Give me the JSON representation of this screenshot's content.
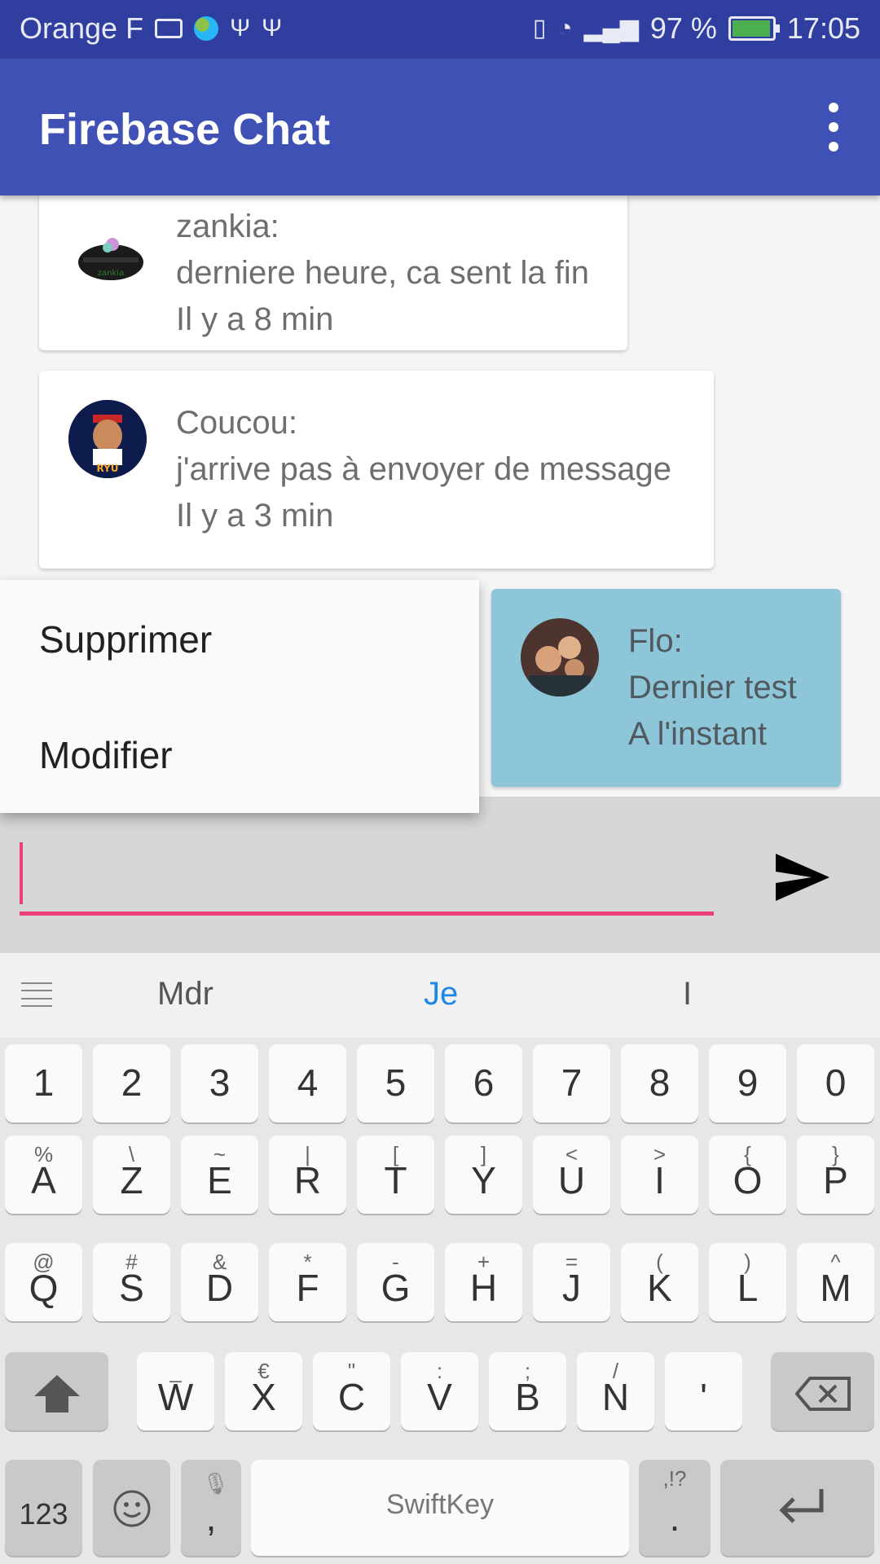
{
  "status_bar": {
    "carrier": "Orange F",
    "battery": "97 %",
    "time": "17:05"
  },
  "app_bar": {
    "title": "Firebase Chat"
  },
  "messages": [
    {
      "author": "zankia:",
      "text": "derniere heure, ca sent la fin",
      "time": "Il y a 8 min",
      "avatar_label": "zankia"
    },
    {
      "author": "Coucou:",
      "text": "j'arrive pas à envoyer de message",
      "time": "Il y a 3 min",
      "avatar_label": "RYU"
    },
    {
      "author": "Flo:",
      "text": "Dernier test",
      "time": "A l'instant"
    }
  ],
  "context_menu": {
    "items": [
      "Supprimer",
      "Modifier"
    ]
  },
  "composer": {
    "value": ""
  },
  "keyboard": {
    "suggestions": [
      "Mdr",
      "Je",
      "I"
    ],
    "number_row": [
      "1",
      "2",
      "3",
      "4",
      "5",
      "6",
      "7",
      "8",
      "9",
      "0"
    ],
    "row1": [
      {
        "main": "A",
        "sec": "%"
      },
      {
        "main": "Z",
        "sec": "\\"
      },
      {
        "main": "E",
        "sec": "~"
      },
      {
        "main": "R",
        "sec": "|"
      },
      {
        "main": "T",
        "sec": "["
      },
      {
        "main": "Y",
        "sec": "]"
      },
      {
        "main": "U",
        "sec": "<"
      },
      {
        "main": "I",
        "sec": ">"
      },
      {
        "main": "O",
        "sec": "{"
      },
      {
        "main": "P",
        "sec": "}"
      }
    ],
    "row2": [
      {
        "main": "Q",
        "sec": "@"
      },
      {
        "main": "S",
        "sec": "#"
      },
      {
        "main": "D",
        "sec": "&"
      },
      {
        "main": "F",
        "sec": "*"
      },
      {
        "main": "G",
        "sec": "-"
      },
      {
        "main": "H",
        "sec": "+"
      },
      {
        "main": "J",
        "sec": "="
      },
      {
        "main": "K",
        "sec": "("
      },
      {
        "main": "L",
        "sec": ")"
      },
      {
        "main": "M",
        "sec": "^"
      }
    ],
    "row3": [
      {
        "main": "W",
        "sec": "_"
      },
      {
        "main": "X",
        "sec": "€"
      },
      {
        "main": "C",
        "sec": "\""
      },
      {
        "main": "V",
        "sec": ":"
      },
      {
        "main": "B",
        "sec": ";"
      },
      {
        "main": "N",
        "sec": "/"
      },
      {
        "main": "'",
        "sec": ""
      }
    ],
    "numbers_key": "123",
    "comma_key": ",",
    "period_key": ".",
    "period_sec": ",!?",
    "space_brand": "SwiftKey"
  }
}
